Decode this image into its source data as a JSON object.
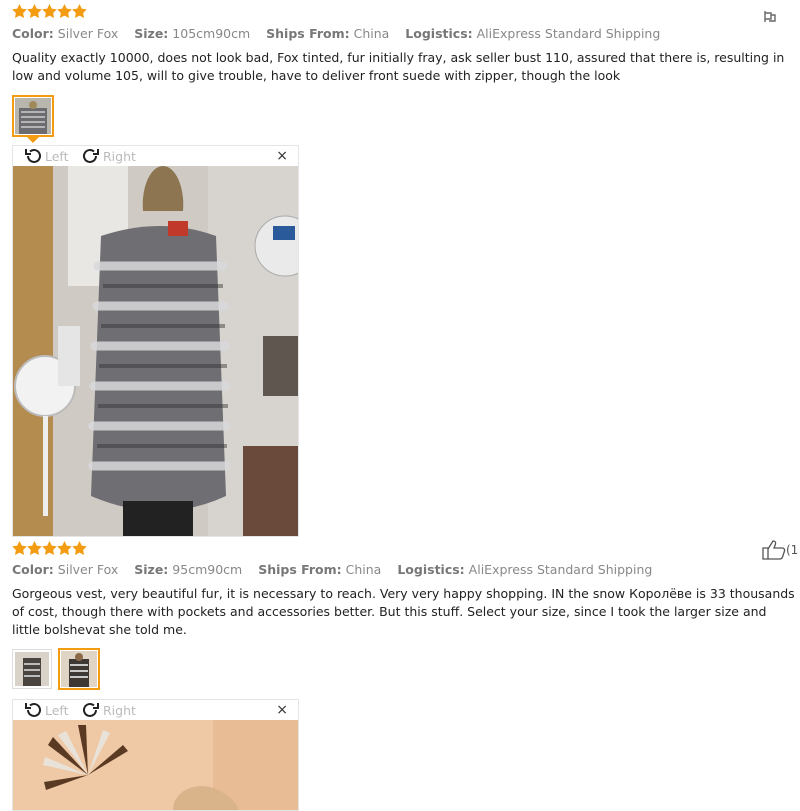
{
  "review1": {
    "color_label": "Color:",
    "color_value": "Silver Fox",
    "size_label": "Size:",
    "size_value": "105cm90cm",
    "ships_label": "Ships From:",
    "ships_value": "China",
    "logistics_label": "Logistics:",
    "logistics_value": "AliExpress Standard Shipping",
    "text": "Quality exactly 10000, does not look bad, Fox tinted, fur initially fray, ask seller bust 110, assured that there is, resulting in low and volume 105, will to give trouble, have to deliver front suede with zipper, though the look",
    "rotate_left_label": "Left",
    "rotate_right_label": "Right",
    "close_label": "×"
  },
  "review2": {
    "color_label": "Color:",
    "color_value": "Silver Fox",
    "size_label": "Size:",
    "size_value": "95cm90cm",
    "ships_label": "Ships From:",
    "ships_value": "China",
    "logistics_label": "Logistics:",
    "logistics_value": "AliExpress Standard Shipping",
    "text": "Gorgeous vest, very beautiful fur, it is necessary to reach. Very very happy shopping. IN the snow Королёве is 33 thousands of cost, though there with pockets and accessories better. But this stuff. Select your size, since I took the larger size and little bolshevat she told me.",
    "helpful_count": "(1",
    "rotate_left_label": "Left",
    "rotate_right_label": "Right",
    "close_label": "×"
  },
  "colors": {
    "star": "#f39c12",
    "accent": "#f39c12"
  },
  "icons": {
    "star": "star-icon",
    "rotate_left": "rotate-left-icon",
    "rotate_right": "rotate-right-icon",
    "close": "close-icon",
    "like": "thumbs-up-icon",
    "report": "flag-icon"
  }
}
